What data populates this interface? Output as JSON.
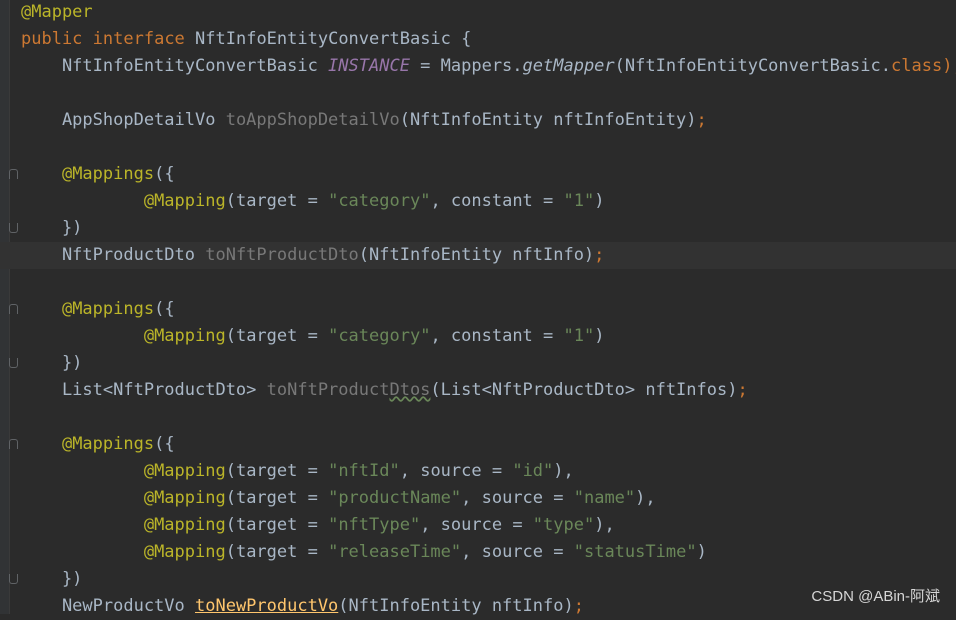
{
  "editor": {
    "lines": [
      {
        "tokens": [
          {
            "t": "@Mapper",
            "c": "anno"
          }
        ]
      },
      {
        "tokens": [
          {
            "t": "public",
            "c": "kw"
          },
          {
            "t": " "
          },
          {
            "t": "interface",
            "c": "kw"
          },
          {
            "t": " NftInfoEntityConvertBasic {"
          }
        ]
      },
      {
        "tokens": [
          {
            "t": "    NftInfoEntityConvertBasic "
          },
          {
            "t": "INSTANCE",
            "c": "static"
          },
          {
            "t": " = Mappers."
          },
          {
            "t": "getMapper",
            "c": "method-italic"
          },
          {
            "t": "(NftInfoEntityConvertBasic."
          },
          {
            "t": "class",
            "c": "kw"
          },
          {
            "t": ");",
            "c": "kw"
          }
        ]
      },
      {
        "tokens": []
      },
      {
        "tokens": [
          {
            "t": "    AppShopDetailVo "
          },
          {
            "t": "toAppShopDetailVo",
            "c": "gray"
          },
          {
            "t": "(NftInfoEntity nftInfoEntity)"
          },
          {
            "t": ";",
            "c": "kw"
          }
        ]
      },
      {
        "tokens": []
      },
      {
        "tokens": [
          {
            "t": "    "
          },
          {
            "t": "@Mappings",
            "c": "anno"
          },
          {
            "t": "({"
          }
        ]
      },
      {
        "tokens": [
          {
            "t": "            "
          },
          {
            "t": "@Mapping",
            "c": "anno"
          },
          {
            "t": "(target = "
          },
          {
            "t": "\"category\"",
            "c": "str"
          },
          {
            "t": ", constant = "
          },
          {
            "t": "\"1\"",
            "c": "str"
          },
          {
            "t": ")"
          }
        ]
      },
      {
        "tokens": [
          {
            "t": "    })"
          }
        ]
      },
      {
        "tokens": [
          {
            "t": "    NftProductDto "
          },
          {
            "t": "toNftProductDto",
            "c": "gray"
          },
          {
            "t": "(NftInfoEntity nftInfo)"
          },
          {
            "t": ";",
            "c": "kw"
          }
        ]
      },
      {
        "tokens": []
      },
      {
        "tokens": [
          {
            "t": "    "
          },
          {
            "t": "@Mappings",
            "c": "anno"
          },
          {
            "t": "({"
          }
        ]
      },
      {
        "tokens": [
          {
            "t": "            "
          },
          {
            "t": "@Mapping",
            "c": "anno"
          },
          {
            "t": "(target = "
          },
          {
            "t": "\"category\"",
            "c": "str"
          },
          {
            "t": ", constant = "
          },
          {
            "t": "\"1\"",
            "c": "str"
          },
          {
            "t": ")"
          }
        ]
      },
      {
        "tokens": [
          {
            "t": "    })"
          }
        ]
      },
      {
        "tokens": [
          {
            "t": "    List<NftProductDto> "
          },
          {
            "t": "toNftProductDtos",
            "c": "gray"
          },
          {
            "t": "(List<NftProductDto> nftInfos)"
          },
          {
            "t": ";",
            "c": "kw"
          }
        ]
      },
      {
        "tokens": []
      },
      {
        "tokens": [
          {
            "t": "    "
          },
          {
            "t": "@Mappings",
            "c": "anno"
          },
          {
            "t": "({"
          }
        ]
      },
      {
        "tokens": [
          {
            "t": "            "
          },
          {
            "t": "@Mapping",
            "c": "anno"
          },
          {
            "t": "(target = "
          },
          {
            "t": "\"nftId\"",
            "c": "str"
          },
          {
            "t": ", source = "
          },
          {
            "t": "\"id\"",
            "c": "str"
          },
          {
            "t": "),"
          }
        ]
      },
      {
        "tokens": [
          {
            "t": "            "
          },
          {
            "t": "@Mapping",
            "c": "anno"
          },
          {
            "t": "(target = "
          },
          {
            "t": "\"productName\"",
            "c": "str"
          },
          {
            "t": ", source = "
          },
          {
            "t": "\"name\"",
            "c": "str"
          },
          {
            "t": "),"
          }
        ]
      },
      {
        "tokens": [
          {
            "t": "            "
          },
          {
            "t": "@Mapping",
            "c": "anno"
          },
          {
            "t": "(target = "
          },
          {
            "t": "\"nftType\"",
            "c": "str"
          },
          {
            "t": ", source = "
          },
          {
            "t": "\"type\"",
            "c": "str"
          },
          {
            "t": "),"
          }
        ]
      },
      {
        "tokens": [
          {
            "t": "            "
          },
          {
            "t": "@Mapping",
            "c": "anno"
          },
          {
            "t": "(target = "
          },
          {
            "t": "\"releaseTime\"",
            "c": "str"
          },
          {
            "t": ", source = "
          },
          {
            "t": "\"statusTime\"",
            "c": "str"
          },
          {
            "t": ")"
          }
        ]
      },
      {
        "tokens": [
          {
            "t": "    })"
          }
        ]
      },
      {
        "tokens": [
          {
            "t": "    NewProductVo "
          },
          {
            "t": "toNewProductVo",
            "c": "method-decl"
          },
          {
            "t": "(NftInfoEntity nftInfo)"
          },
          {
            "t": ";",
            "c": "kw"
          }
        ]
      }
    ],
    "current_line": 10
  },
  "watermark": "CSDN @ABin-阿斌"
}
